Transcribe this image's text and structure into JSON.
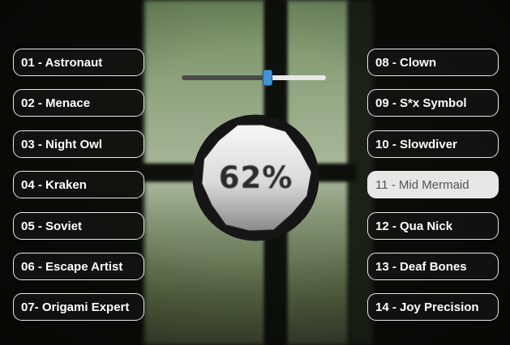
{
  "left_tracks": [
    {
      "label": "01 - Astronaut"
    },
    {
      "label": "02 - Menace"
    },
    {
      "label": "03 - Night Owl"
    },
    {
      "label": "04 - Kraken"
    },
    {
      "label": "05 - Soviet"
    },
    {
      "label": "06 - Escape Artist"
    },
    {
      "label": "07- Origami Expert"
    }
  ],
  "right_tracks": [
    {
      "label": "08 - Clown"
    },
    {
      "label": "09 - S*x Symbol"
    },
    {
      "label": "10 - Slowdiver"
    },
    {
      "label": "11 - Mid Mermaid",
      "selected": true
    },
    {
      "label": "12 - Qua Nick"
    },
    {
      "label": "13 - Deaf Bones"
    },
    {
      "label": "14 - Joy Precision"
    }
  ],
  "volume": {
    "level": 0.6,
    "display": "62%"
  },
  "colors": {
    "button_border": "#e9e9e9",
    "selected_bg": "#e6e6e6",
    "slider_thumb": "#3f95d9"
  }
}
